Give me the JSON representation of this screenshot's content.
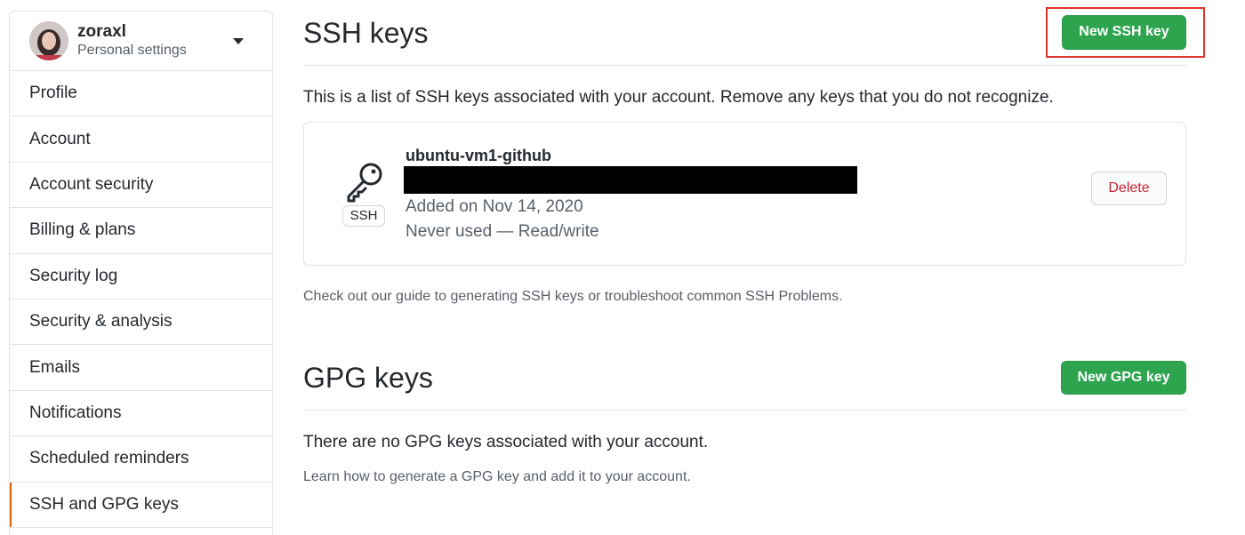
{
  "sidebar": {
    "username": "zoraxl",
    "context": "Personal settings",
    "items": [
      {
        "label": "Profile"
      },
      {
        "label": "Account"
      },
      {
        "label": "Account security"
      },
      {
        "label": "Billing & plans"
      },
      {
        "label": "Security log"
      },
      {
        "label": "Security & analysis"
      },
      {
        "label": "Emails"
      },
      {
        "label": "Notifications"
      },
      {
        "label": "Scheduled reminders"
      },
      {
        "label": "SSH and GPG keys"
      }
    ]
  },
  "ssh": {
    "title": "SSH keys",
    "new_button": "New SSH key",
    "description": "This is a list of SSH keys associated with your account. Remove any keys that you do not recognize.",
    "key": {
      "name": "ubuntu-vm1-github",
      "badge": "SSH",
      "added": "Added on Nov 14, 2020",
      "usage": "Never used — Read/write",
      "delete_label": "Delete"
    },
    "guide_text": "Check out our guide to generating SSH keys or troubleshoot common SSH Problems."
  },
  "gpg": {
    "title": "GPG keys",
    "new_button": "New GPG key",
    "empty_text": "There are no GPG keys associated with your account.",
    "learn_text": "Learn how to generate a GPG key and add it to your account."
  },
  "colors": {
    "primary_button": "#2ea44f",
    "danger_text": "#cb2431",
    "highlight_box": "#e0332e"
  }
}
